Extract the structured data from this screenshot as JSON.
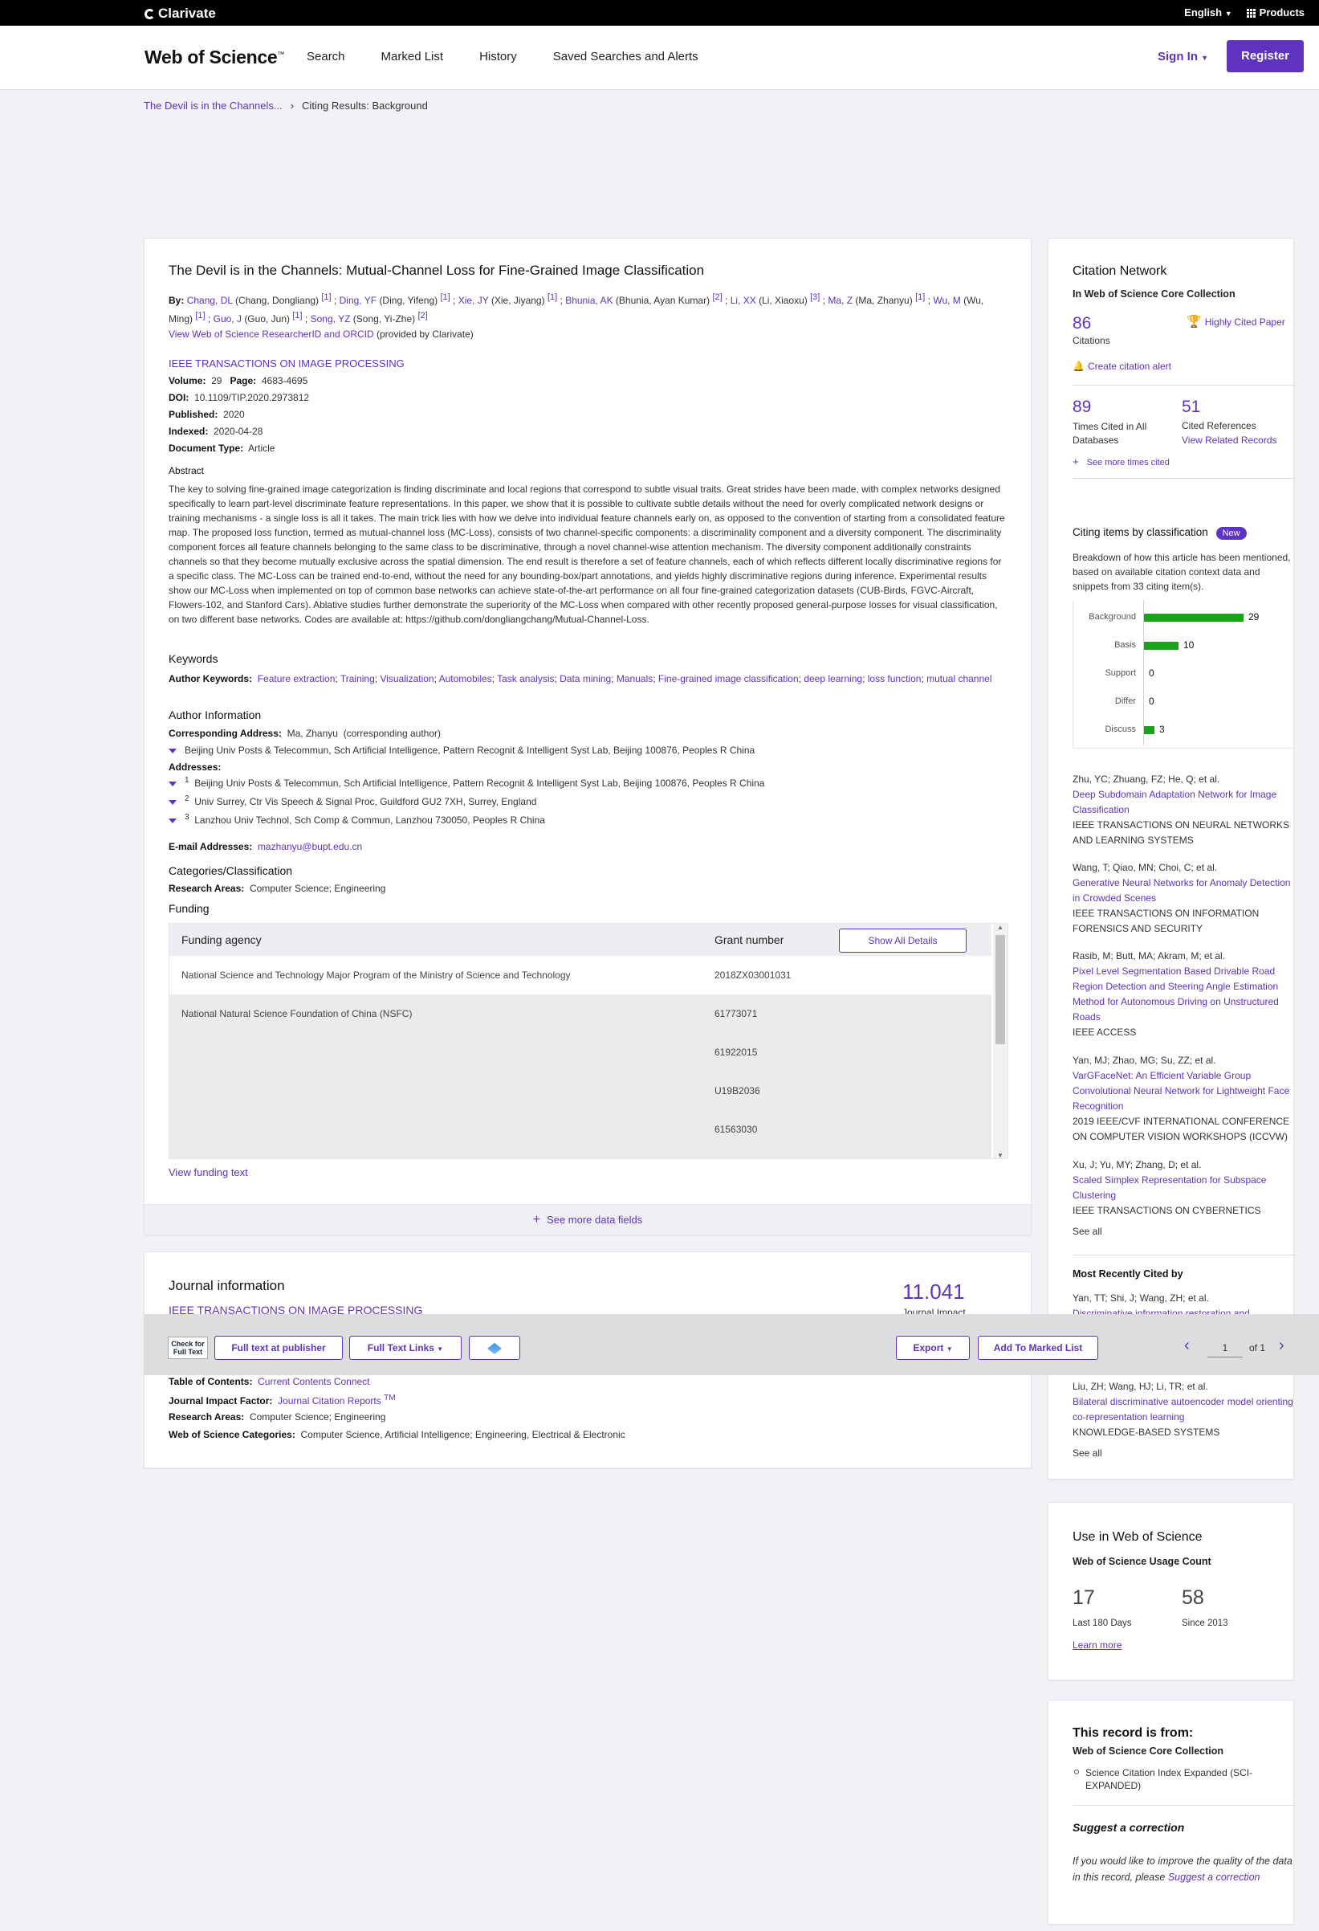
{
  "topbar": {
    "brand": "Clarivate",
    "language": "English",
    "products": "Products"
  },
  "header": {
    "logo": "Web of Science",
    "logo_tm": "™",
    "nav": [
      "Search",
      "Marked List",
      "History",
      "Saved Searches and Alerts"
    ],
    "signin": "Sign In",
    "register": "Register"
  },
  "breadcrumb": {
    "parent": "The Devil is in the Channels...",
    "current": "Citing Results: Background"
  },
  "record": {
    "title": "The Devil is in the Channels: Mutual-Channel Loss for Fine-Grained Image Classification",
    "by_label": "By:",
    "authors": [
      {
        "short": "Chang, DL",
        "full": "(Chang, Dongliang)",
        "aff": "[1]"
      },
      {
        "short": "Ding, YF",
        "full": "(Ding, Yifeng)",
        "aff": "[1]"
      },
      {
        "short": "Xie, JY",
        "full": "(Xie, Jiyang)",
        "aff": "[1]"
      },
      {
        "short": "Bhunia, AK",
        "full": "(Bhunia, Ayan Kumar)",
        "aff": "[2]"
      },
      {
        "short": "Li, XX",
        "full": "(Li, Xiaoxu)",
        "aff": "[3]"
      },
      {
        "short": "Ma, Z",
        "full": "(Ma, Zhanyu)",
        "aff": "[1]"
      },
      {
        "short": "Wu, M",
        "full": "(Wu, Ming)",
        "aff": "[1]"
      },
      {
        "short": "Guo, J",
        "full": "(Guo, Jun)",
        "aff": "[1]"
      },
      {
        "short": "Song, YZ",
        "full": "(Song, Yi-Zhe)",
        "aff": "[2]"
      }
    ],
    "researcher_link": "View Web of Science ResearcherID and ORCID",
    "researcher_note": "(provided by Clarivate)",
    "journal": "IEEE TRANSACTIONS ON IMAGE PROCESSING",
    "volume_label": "Volume:",
    "volume": "29",
    "page_label": "Page:",
    "page": "4683-4695",
    "doi_label": "DOI:",
    "doi": "10.1109/TIP.2020.2973812",
    "published_label": "Published:",
    "published": "2020",
    "indexed_label": "Indexed:",
    "indexed": "2020-04-28",
    "doctype_label": "Document Type:",
    "doctype": "Article",
    "abstract_label": "Abstract",
    "abstract": "The key to solving fine-grained image categorization is finding discriminate and local regions that correspond to subtle visual traits. Great strides have been made, with complex networks designed specifically to learn part-level discriminate feature representations. In this paper, we show that it is possible to cultivate subtle details without the need for overly complicated network designs or training mechanisms - a single loss is all it takes. The main trick lies with how we delve into individual feature channels early on, as opposed to the convention of starting from a consolidated feature map. The proposed loss function, termed as mutual-channel loss (MC-Loss), consists of two channel-specific components: a discriminality component and a diversity component. The discriminality component forces all feature channels belonging to the same class to be discriminative, through a novel channel-wise attention mechanism. The diversity component additionally constraints channels so that they become mutually exclusive across the spatial dimension. The end result is therefore a set of feature channels, each of which reflects different locally discriminative regions for a specific class. The MC-Loss can be trained end-to-end, without the need for any bounding-box/part annotations, and yields highly discriminative regions during inference. Experimental results show our MC-Loss when implemented on top of common base networks can achieve state-of-the-art performance on all four fine-grained categorization datasets (CUB-Birds, FGVC-Aircraft, Flowers-102, and Stanford Cars). Ablative studies further demonstrate the superiority of the MC-Loss when compared with other recently proposed general-purpose losses for visual classification, on two different base networks. Codes are available at: https://github.com/dongliangchang/Mutual-Channel-Loss.",
    "keywords_label": "Keywords",
    "author_keywords_label": "Author Keywords:",
    "author_keywords": [
      "Feature extraction",
      "Training",
      "Visualization",
      "Automobiles",
      "Task analysis",
      "Data mining",
      "Manuals",
      "Fine-grained image classification",
      "deep learning",
      "loss function",
      "mutual channel"
    ],
    "author_info_label": "Author Information",
    "corresponding_label": "Corresponding Address:",
    "corresponding": "Ma, Zhanyu",
    "corresponding_note": "(corresponding author)",
    "corresponding_addr": "Beijing Univ Posts & Telecommun, Sch Artificial Intelligence, Pattern Recognit & Intelligent Syst Lab, Beijing 100876, Peoples R China",
    "addresses_label": "Addresses:",
    "addresses": [
      {
        "n": "1",
        "text": "Beijing Univ Posts & Telecommun, Sch Artificial Intelligence, Pattern Recognit & Intelligent Syst Lab, Beijing 100876, Peoples R China"
      },
      {
        "n": "2",
        "text": "Univ Surrey, Ctr Vis Speech & Signal Proc, Guildford GU2 7XH, Surrey, England"
      },
      {
        "n": "3",
        "text": "Lanzhou Univ Technol, Sch Comp & Commun, Lanzhou 730050, Peoples R China"
      }
    ],
    "email_label": "E-mail Addresses:",
    "email": "mazhanyu@bupt.edu.cn",
    "categories_label": "Categories/Classification",
    "research_areas_label": "Research Areas:",
    "research_areas": "Computer Science; Engineering",
    "funding_label": "Funding",
    "funding_col_agency": "Funding agency",
    "funding_col_grant": "Grant number",
    "show_all_details": "Show All Details",
    "funding_rows": [
      {
        "agency": "National Science and Technology Major Program of the Ministry of Science and Technology",
        "grant": "2018ZX03001031"
      },
      {
        "agency": "National Natural Science Foundation of China (NSFC)",
        "grant": "61773071"
      },
      {
        "agency": "",
        "grant": "61922015"
      },
      {
        "agency": "",
        "grant": "U19B2036"
      },
      {
        "agency": "",
        "grant": "61563030"
      }
    ],
    "view_funding_text": "View funding text",
    "see_more": "See more data fields"
  },
  "journal_card": {
    "title": "Journal information",
    "journal": "IEEE TRANSACTIONS ON IMAGE PROCESSING",
    "impact": "11.041",
    "impact_caption": "Journal Impact",
    "toc_label": "Table of Contents:",
    "toc": "Current Contents Connect",
    "jif_label": "Journal Impact Factor:",
    "jif": "Journal Citation Reports",
    "jif_tm": "TM",
    "ra_label": "Research Areas:",
    "ra": "Computer Science; Engineering",
    "cats_label": "Web of Science Categories:",
    "cats": "Computer Science, Artificial Intelligence; Engineering, Electrical & Electronic"
  },
  "toolbar": {
    "check_label": "Check for Full Text",
    "full_text": "Full text at publisher",
    "full_text_links": "Full Text Links",
    "export": "Export",
    "add_marked": "Add To Marked List",
    "page_value": "1",
    "of_label": "of 1"
  },
  "citation_network": {
    "title": "Citation Network",
    "subtitle": "In Web of Science Core Collection",
    "citations": "86",
    "citations_label": "Citations",
    "highly_cited": "Highly Cited Paper",
    "create_alert": "Create citation alert",
    "times_cited_all": "89",
    "times_cited_all_label": "Times Cited in All Databases",
    "cited_refs": "51",
    "cited_refs_label": "Cited References",
    "view_related": "View Related Records",
    "see_more_times": "See more times cited",
    "classification_title": "Citing items by classification",
    "new_badge": "New",
    "classification_desc": "Breakdown of how this article has been mentioned, based on available citation context data and snippets from 33 citing item(s).",
    "citing_items": [
      {
        "authors": "Zhu, YC; Zhuang, FZ; He, Q; et al.",
        "title": "Deep Subdomain Adaptation Network for Image Classification",
        "journal": "IEEE TRANSACTIONS ON NEURAL NETWORKS AND LEARNING SYSTEMS"
      },
      {
        "authors": "Wang, T; Qiao, MN; Choi, C; et al.",
        "title": "Generative Neural Networks for Anomaly Detection in Crowded Scenes",
        "journal": "IEEE TRANSACTIONS ON INFORMATION FORENSICS AND SECURITY"
      },
      {
        "authors": "Rasib, M; Butt, MA; Akram, M; et al.",
        "title": "Pixel Level Segmentation Based Drivable Road Region Detection and Steering Angle Estimation Method for Autonomous Driving on Unstructured Roads",
        "journal": "IEEE ACCESS"
      },
      {
        "authors": "Yan, MJ; Zhao, MG; Su, ZZ; et al.",
        "title": "VarGFaceNet: An Efficient Variable Group Convolutional Neural Network for Lightweight Face Recognition",
        "journal": "2019 IEEE/CVF INTERNATIONAL CONFERENCE ON COMPUTER VISION WORKSHOPS (ICCVW)"
      },
      {
        "authors": "Xu, J; Yu, MY; Zhang, D; et al.",
        "title": "Scaled Simplex Representation for Subspace Clustering",
        "journal": "IEEE TRANSACTIONS ON CYBERNETICS"
      }
    ],
    "see_all": "See all",
    "recent_title": "Most Recently Cited by",
    "recent_items": [
      {
        "authors": "Yan, TT; Shi, J; Wang, ZH; et al.",
        "title": "Discriminative information restoration and...",
        "journal": ""
      },
      {
        "authors": "Liu, ZH; Wang, HJ; Li, TR; et al.",
        "title": "Bilateral discriminative autoencoder model orienting co-representation learning",
        "journal": "KNOWLEDGE-BASED SYSTEMS"
      }
    ],
    "see_all_2": "See all"
  },
  "chart_data": {
    "type": "bar",
    "categories": [
      "Background",
      "Basis",
      "Support",
      "Differ",
      "Discuss"
    ],
    "values": [
      29,
      10,
      0,
      0,
      3
    ],
    "xlim": [
      0,
      29
    ],
    "color": "#1aa31a"
  },
  "usage": {
    "title": "Use in Web of Science",
    "subtitle": "Web of Science Usage Count",
    "last180": "17",
    "last180_label": "Last 180 Days",
    "since2013": "58",
    "since2013_label": "Since 2013",
    "learn_more": "Learn more"
  },
  "record_from": {
    "title": "This record is from:",
    "collection": "Web of Science Core Collection",
    "index": "Science Citation Index Expanded (SCI-EXPANDED)",
    "suggest_title": "Suggest a correction",
    "suggest_text": "If you would like to improve the quality of the data in this record, please",
    "suggest_link": "Suggest a correction"
  },
  "colors": {
    "accent": "#5e33bf",
    "bar": "#1aa31a",
    "topbar": "#000000"
  }
}
